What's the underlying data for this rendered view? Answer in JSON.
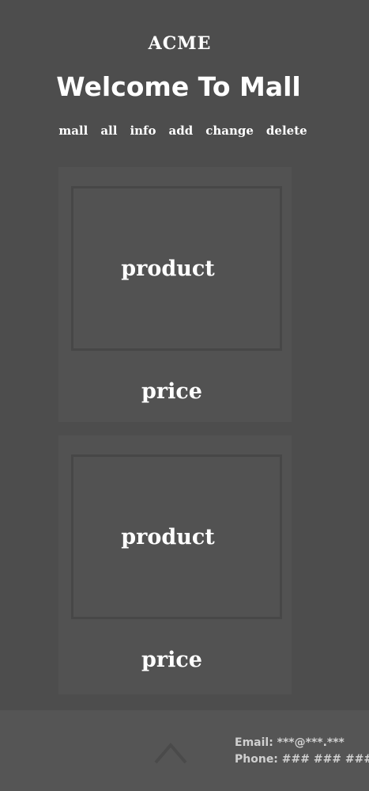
{
  "header": {
    "brand": "ACME",
    "welcome": "Welcome To Mall"
  },
  "nav": {
    "items": [
      "mall",
      "all",
      "info",
      "add",
      "change",
      "delete"
    ]
  },
  "products": [
    {
      "product_label": "product",
      "price_label": "price"
    },
    {
      "product_label": "product",
      "price_label": "price"
    }
  ],
  "footer": {
    "email": "Email: ***@***.***",
    "phone": "Phone: ### ### ###",
    "scroll_top_icon": "chevron-up-icon"
  },
  "colors": {
    "background": "#4d4d4d",
    "card": "#525252",
    "footer": "#555555",
    "text": "#ffffff",
    "footer_text": "#d0d0d0"
  }
}
